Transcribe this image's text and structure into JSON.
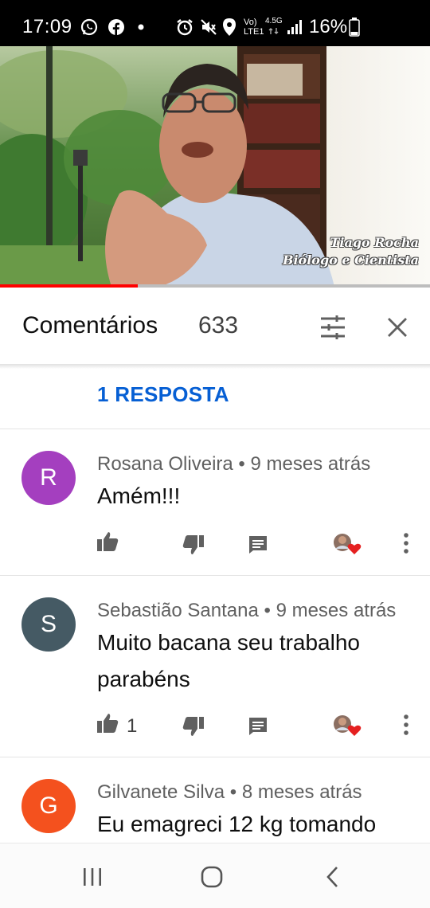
{
  "status_bar": {
    "time": "17:09",
    "network_top": "Vo)",
    "network_bottom": "LTE1",
    "network_gen": "4.5G",
    "battery_percent": "16%",
    "icons": [
      "whatsapp-icon",
      "facebook-icon",
      "dot-icon",
      "alarm-icon",
      "mute-icon",
      "location-icon",
      "signal-icon",
      "battery-icon"
    ]
  },
  "video": {
    "caption_line1": "Tiago Rocha",
    "caption_line2": "Biólogo e Cientista",
    "progress": 0.32
  },
  "comments_header": {
    "title": "Comentários",
    "count": "633"
  },
  "reply_link": "1 RESPOSTA",
  "comments": [
    {
      "avatar_letter": "R",
      "avatar_color": "#a43fbf",
      "meta": "Rosana Oliveira • 9 meses atrás",
      "text": "Amém!!!",
      "likes": ""
    },
    {
      "avatar_letter": "S",
      "avatar_color": "#455a64",
      "meta": "Sebastião Santana • 9 meses atrás",
      "text": "Muito bacana seu trabalho parabéns",
      "likes": "1"
    },
    {
      "avatar_letter": "G",
      "avatar_color": "#f4511e",
      "meta": "Gilvanete Silva • 8 meses atrás",
      "text": "Eu emagreci 12 kg tomando",
      "likes": ""
    }
  ],
  "colors": {
    "link_blue": "#065fd4",
    "progress_red": "#ff0000",
    "heart_red": "#e52020"
  }
}
